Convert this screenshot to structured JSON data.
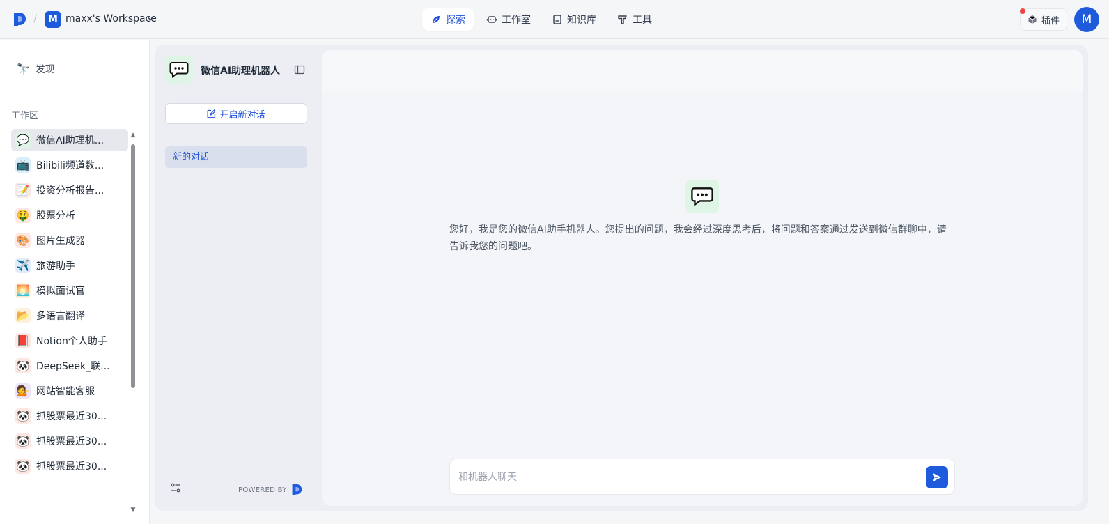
{
  "topbar": {
    "workspace_initial": "M",
    "workspace_name": "maxx's Workspace",
    "nav": [
      {
        "label": "探索",
        "icon": "explore-leaf-icon",
        "active": true
      },
      {
        "label": "工作室",
        "icon": "robot-icon",
        "active": false
      },
      {
        "label": "知识库",
        "icon": "book-icon",
        "active": false
      },
      {
        "label": "工具",
        "icon": "hammer-icon",
        "active": false
      }
    ],
    "plugin_label": "插件",
    "user_initial": "M"
  },
  "sidebar": {
    "discover_label": "发现",
    "section_title": "工作区",
    "bots": [
      {
        "emoji": "💬",
        "label": "微信AI助理机...",
        "bg": "#dff5e6",
        "active": true
      },
      {
        "emoji": "📺",
        "label": "Bilibili频道数...",
        "bg": "#dbeefb",
        "active": false
      },
      {
        "emoji": "📝",
        "label": "投资分析报告...",
        "bg": "#fde7e2",
        "active": false
      },
      {
        "emoji": "🤑",
        "label": "股票分析",
        "bg": "#fde7e2",
        "active": false
      },
      {
        "emoji": "🎨",
        "label": "图片生成器",
        "bg": "#fde7e2",
        "active": false
      },
      {
        "emoji": "✈️",
        "label": "旅游助手",
        "bg": "#e0ecfb",
        "active": false
      },
      {
        "emoji": "🌅",
        "label": "模拟面试官",
        "bg": "#fdf1dc",
        "active": false
      },
      {
        "emoji": "📂",
        "label": "多语言翻译",
        "bg": "#fdf1dc",
        "active": false
      },
      {
        "emoji": "📕",
        "label": "Notion个人助手",
        "bg": "#fde7e2",
        "active": false
      },
      {
        "emoji": "🐼",
        "label": "DeepSeek_联...",
        "bg": "#fde7e2",
        "active": false
      },
      {
        "emoji": "💁",
        "label": "网站智能客服",
        "bg": "#ede4fb",
        "active": false
      },
      {
        "emoji": "🐼",
        "label": "抓股票最近30...",
        "bg": "#fde7e2",
        "active": false
      },
      {
        "emoji": "🐼",
        "label": "抓股票最近30...",
        "bg": "#fde7e2",
        "active": false
      },
      {
        "emoji": "🐼",
        "label": "抓股票最近30...",
        "bg": "#fde7e2",
        "active": false
      }
    ]
  },
  "panel": {
    "bot_name": "微信AI助理机器人",
    "new_chat_label": "开启新对话",
    "conversations": [
      {
        "label": "新的对话",
        "active": true
      }
    ],
    "powered_by": "POWERED BY"
  },
  "chat": {
    "welcome": "您好，我是您的微信AI助手机器人。您提出的问题，我会经过深度思考后，将问题和答案通过发送到微信群聊中，请告诉我您的问题吧。",
    "input_placeholder": "和机器人聊天"
  },
  "colors": {
    "accent": "#1e5bdc",
    "active_text": "#1e4fd6",
    "bot_icon_bg": "#dff5e6"
  }
}
